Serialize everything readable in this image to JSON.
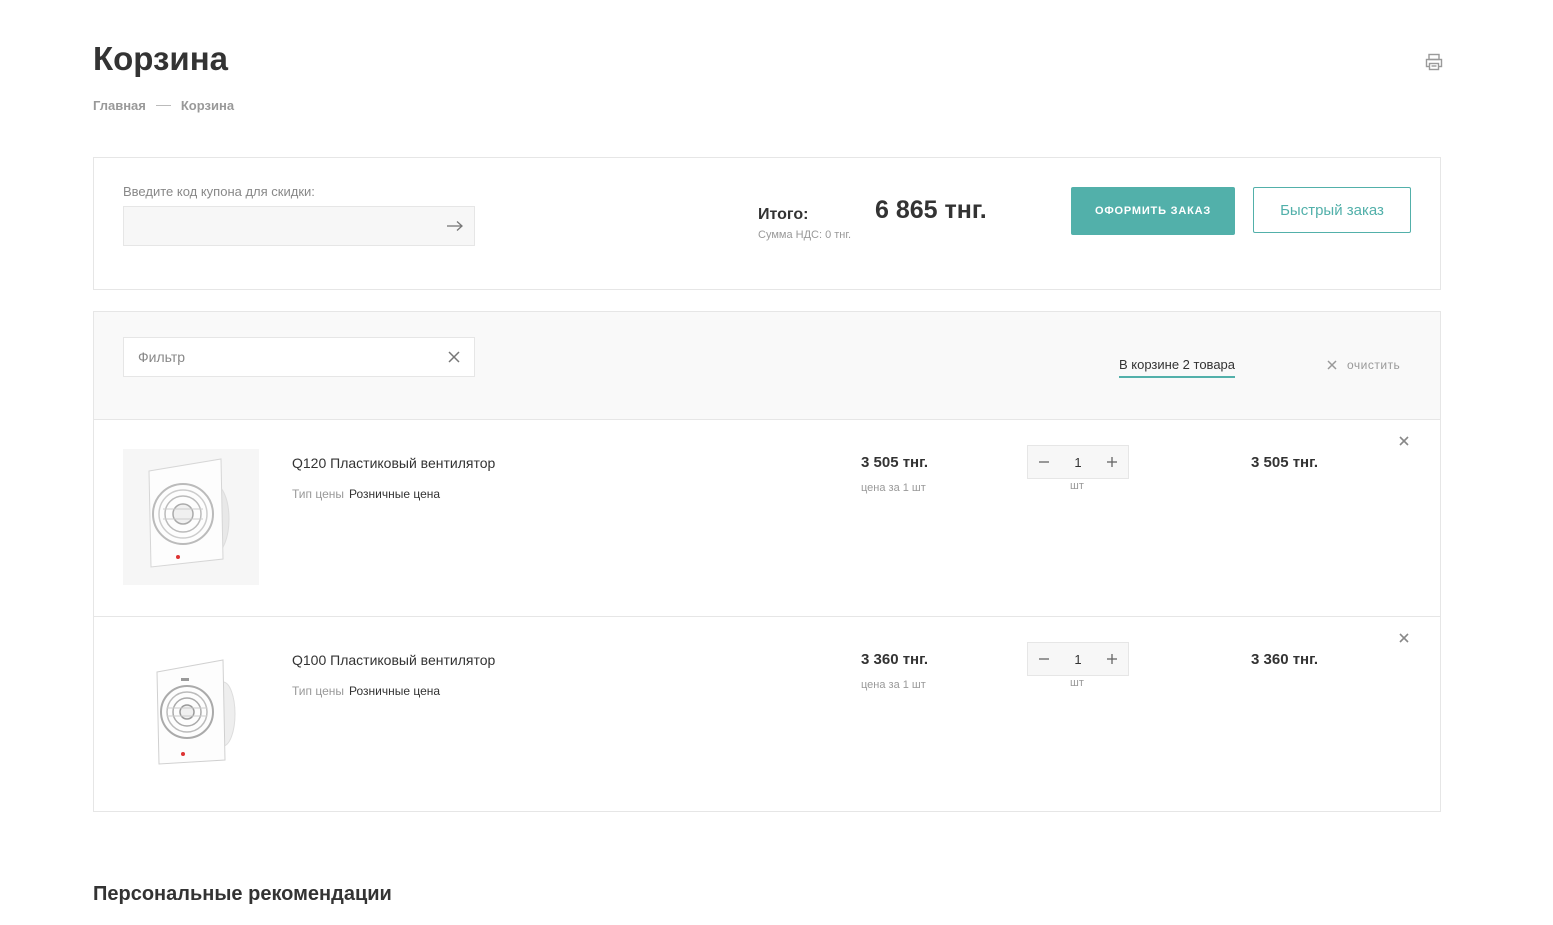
{
  "page": {
    "title": "Корзина"
  },
  "breadcrumb": {
    "home": "Главная",
    "current": "Корзина"
  },
  "summary": {
    "coupon_label": "Введите код купона для скидки:",
    "coupon_value": "",
    "total_label": "Итого:",
    "vat_label": "Сумма НДС: 0 тнг.",
    "total_value": "6 865 тнг.",
    "order_button": "Оформить заказ",
    "fast_order_button": "Быстрый заказ"
  },
  "filter": {
    "placeholder": "Фильтр",
    "cart_count": "В корзине 2 товара",
    "clear_label": "очистить"
  },
  "items": [
    {
      "name": "Q120 Пластиковый вентилятор",
      "price_type_label": "Тип цены",
      "price_type_value": "Розничные цена",
      "price": "3 505 тнг.",
      "price_note": "цена за 1 шт",
      "quantity": "1",
      "unit": "шт",
      "sum": "3 505 тнг."
    },
    {
      "name": "Q100 Пластиковый вентилятор",
      "price_type_label": "Тип цены",
      "price_type_value": "Розничные цена",
      "price": "3 360 тнг.",
      "price_note": "цена за 1 шт",
      "quantity": "1",
      "unit": "шт",
      "sum": "3 360 тнг."
    }
  ],
  "recommendations": {
    "title": "Персональные рекомендации"
  },
  "colors": {
    "accent": "#52b0aa",
    "border": "#e6e6e6",
    "muted": "#999999"
  },
  "icons": [
    "printer-icon",
    "arrow-right-icon",
    "close-icon",
    "minus-icon",
    "plus-icon",
    "fan-icon"
  ]
}
